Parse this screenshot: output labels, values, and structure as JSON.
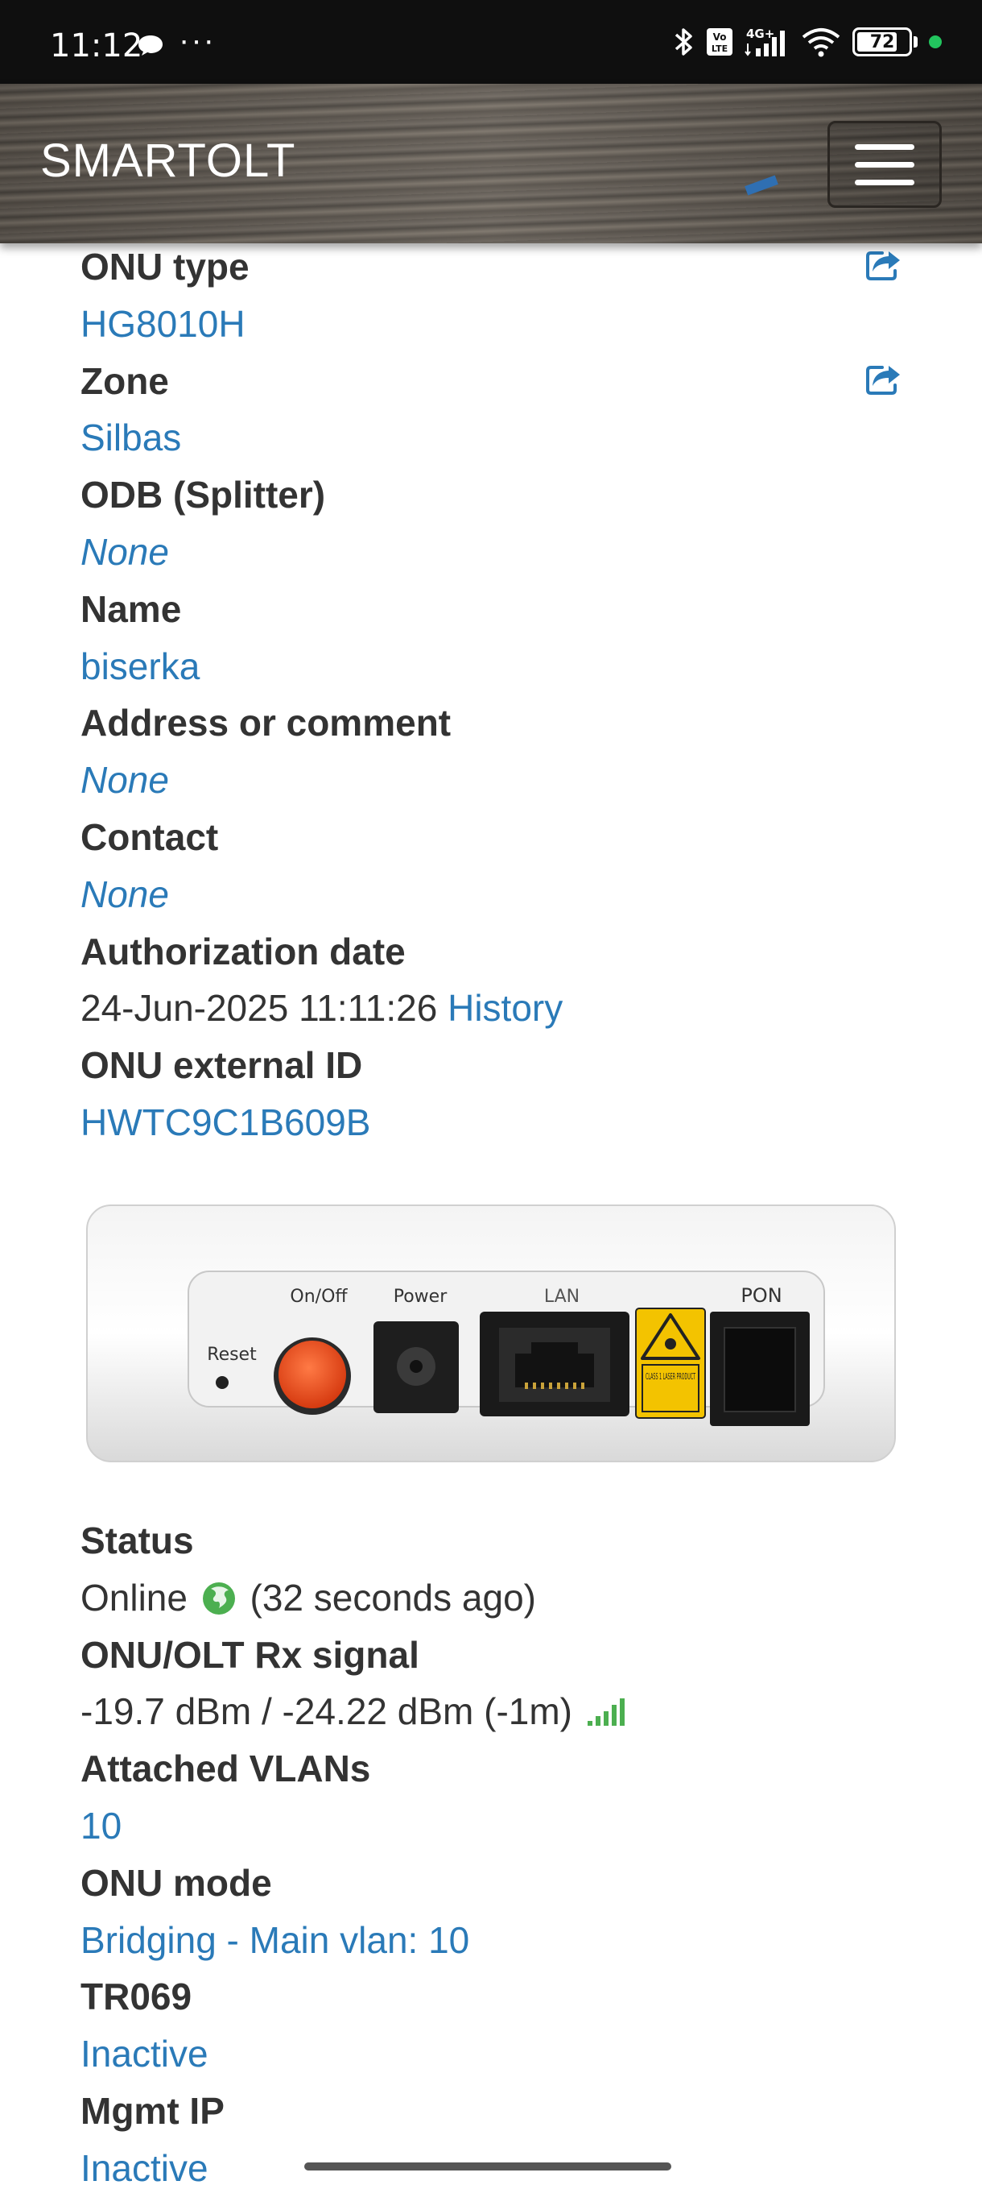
{
  "status_bar": {
    "time": "11:12",
    "dots": "···",
    "battery": "72",
    "icons": [
      "chat-bubble-icon",
      "bluetooth-icon",
      "volte-icon",
      "signal-4g-icon",
      "wifi-icon",
      "battery-icon",
      "green-dot-icon"
    ],
    "network": "4G+"
  },
  "navbar": {
    "brand": "SMARTOLT",
    "menu_icon": "hamburger-menu-icon"
  },
  "details": {
    "onu_type_label": "ONU type",
    "onu_type_value": "HG8010H",
    "zone_label": "Zone",
    "zone_value": "Silbas",
    "odb_label": "ODB (Splitter)",
    "odb_value": "None",
    "name_label": "Name",
    "name_value": "biserka",
    "address_label": "Address or comment",
    "address_value": "None",
    "contact_label": "Contact",
    "contact_value": "None",
    "auth_date_label": "Authorization date",
    "auth_date_value": "24-Jun-2025 11:11:26",
    "history_link": "History",
    "external_id_label": "ONU external ID",
    "external_id_value": "HWTC9C1B609B",
    "edit_icon": "share-edit-icon"
  },
  "device_image": {
    "labels": {
      "reset": "Reset",
      "onoff": "On/Off",
      "power": "Power",
      "lan": "LAN",
      "pon": "PON",
      "laser": "CLASS 1 LASER PRODUCT"
    }
  },
  "status": {
    "status_label": "Status",
    "status_value": "Online",
    "status_time": "(32 seconds ago)",
    "globe_icon": "globe-icon",
    "signal_label": "ONU/OLT Rx signal",
    "signal_value": "-19.7 dBm / -24.22 dBm (-1m)",
    "signal_icon": "signal-bars-icon",
    "vlans_label": "Attached VLANs",
    "vlans_value": "10",
    "mode_label": "ONU mode",
    "mode_value": "Bridging - Main vlan: 10",
    "tr069_label": "TR069",
    "tr069_value": "Inactive",
    "mgmt_ip_label": "Mgmt IP",
    "mgmt_ip_value": "Inactive"
  },
  "colors": {
    "link": "#2a7ab8",
    "label": "#333333",
    "online_green": "#4caf50"
  }
}
